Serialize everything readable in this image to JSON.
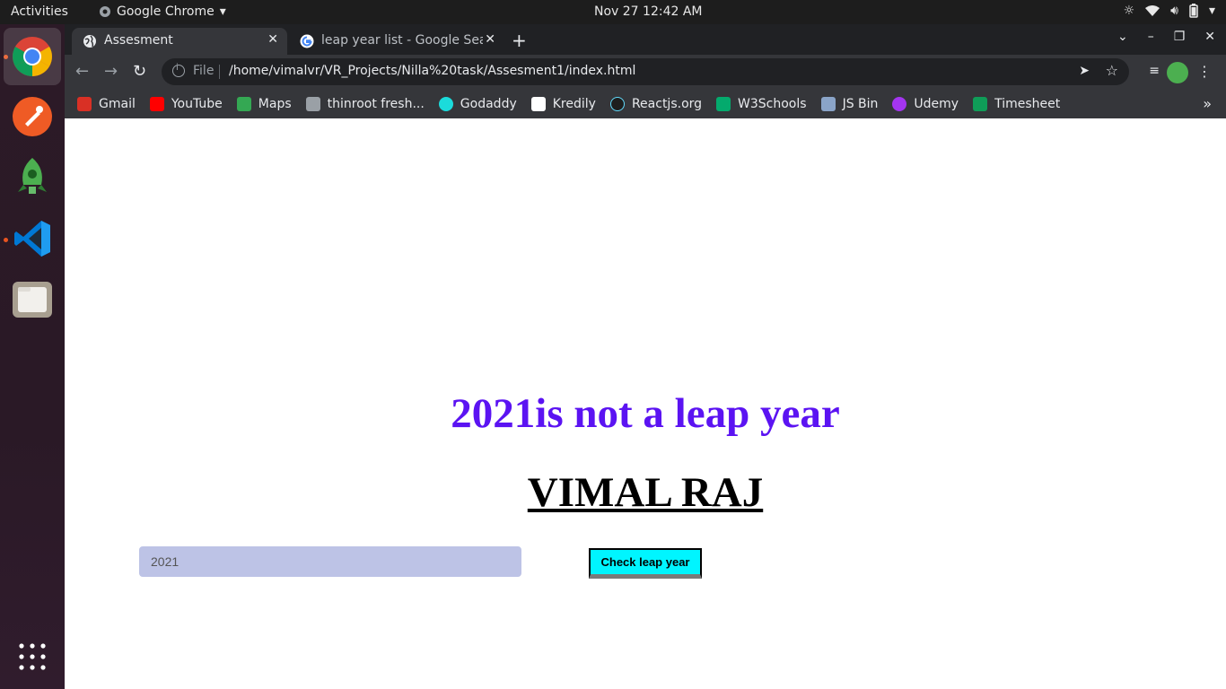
{
  "topbar": {
    "activities": "Activities",
    "app_name": "Google Chrome",
    "clock": "Nov 27  12:42 AM"
  },
  "tabs": [
    {
      "title": "Assesment",
      "active": true
    },
    {
      "title": "leap year list - Google Search",
      "active": false
    }
  ],
  "toolbar": {
    "scheme": "File",
    "url": "/home/vimalvr/VR_Projects/Nilla%20task/Assesment1/index.html"
  },
  "bookmarks": [
    {
      "label": "Gmail",
      "color": "#d93025"
    },
    {
      "label": "YouTube",
      "color": "#ff0000"
    },
    {
      "label": "Maps",
      "color": "#34a853"
    },
    {
      "label": "thinroot fresh...",
      "color": "#9aa0a6"
    },
    {
      "label": "Godaddy",
      "color": "#1bdbdb"
    },
    {
      "label": "Kredily",
      "color": "#ffffff"
    },
    {
      "label": "Reactjs.org",
      "color": "#61dafb"
    },
    {
      "label": "W3Schools",
      "color": "#04aa6d"
    },
    {
      "label": "JS Bin",
      "color": "#8aa4c8"
    },
    {
      "label": "Udemy",
      "color": "#a435f0"
    },
    {
      "label": "Timesheet",
      "color": "#0f9d58"
    }
  ],
  "page": {
    "result_text": "2021is not a leap year",
    "author": "VIMAL RAJ",
    "year_input_value": "2021",
    "check_button_label": "Check leap year"
  },
  "colors": {
    "result": "#5b13f2",
    "button": "#00f5ff",
    "input_bg": "#bdc3e6"
  }
}
